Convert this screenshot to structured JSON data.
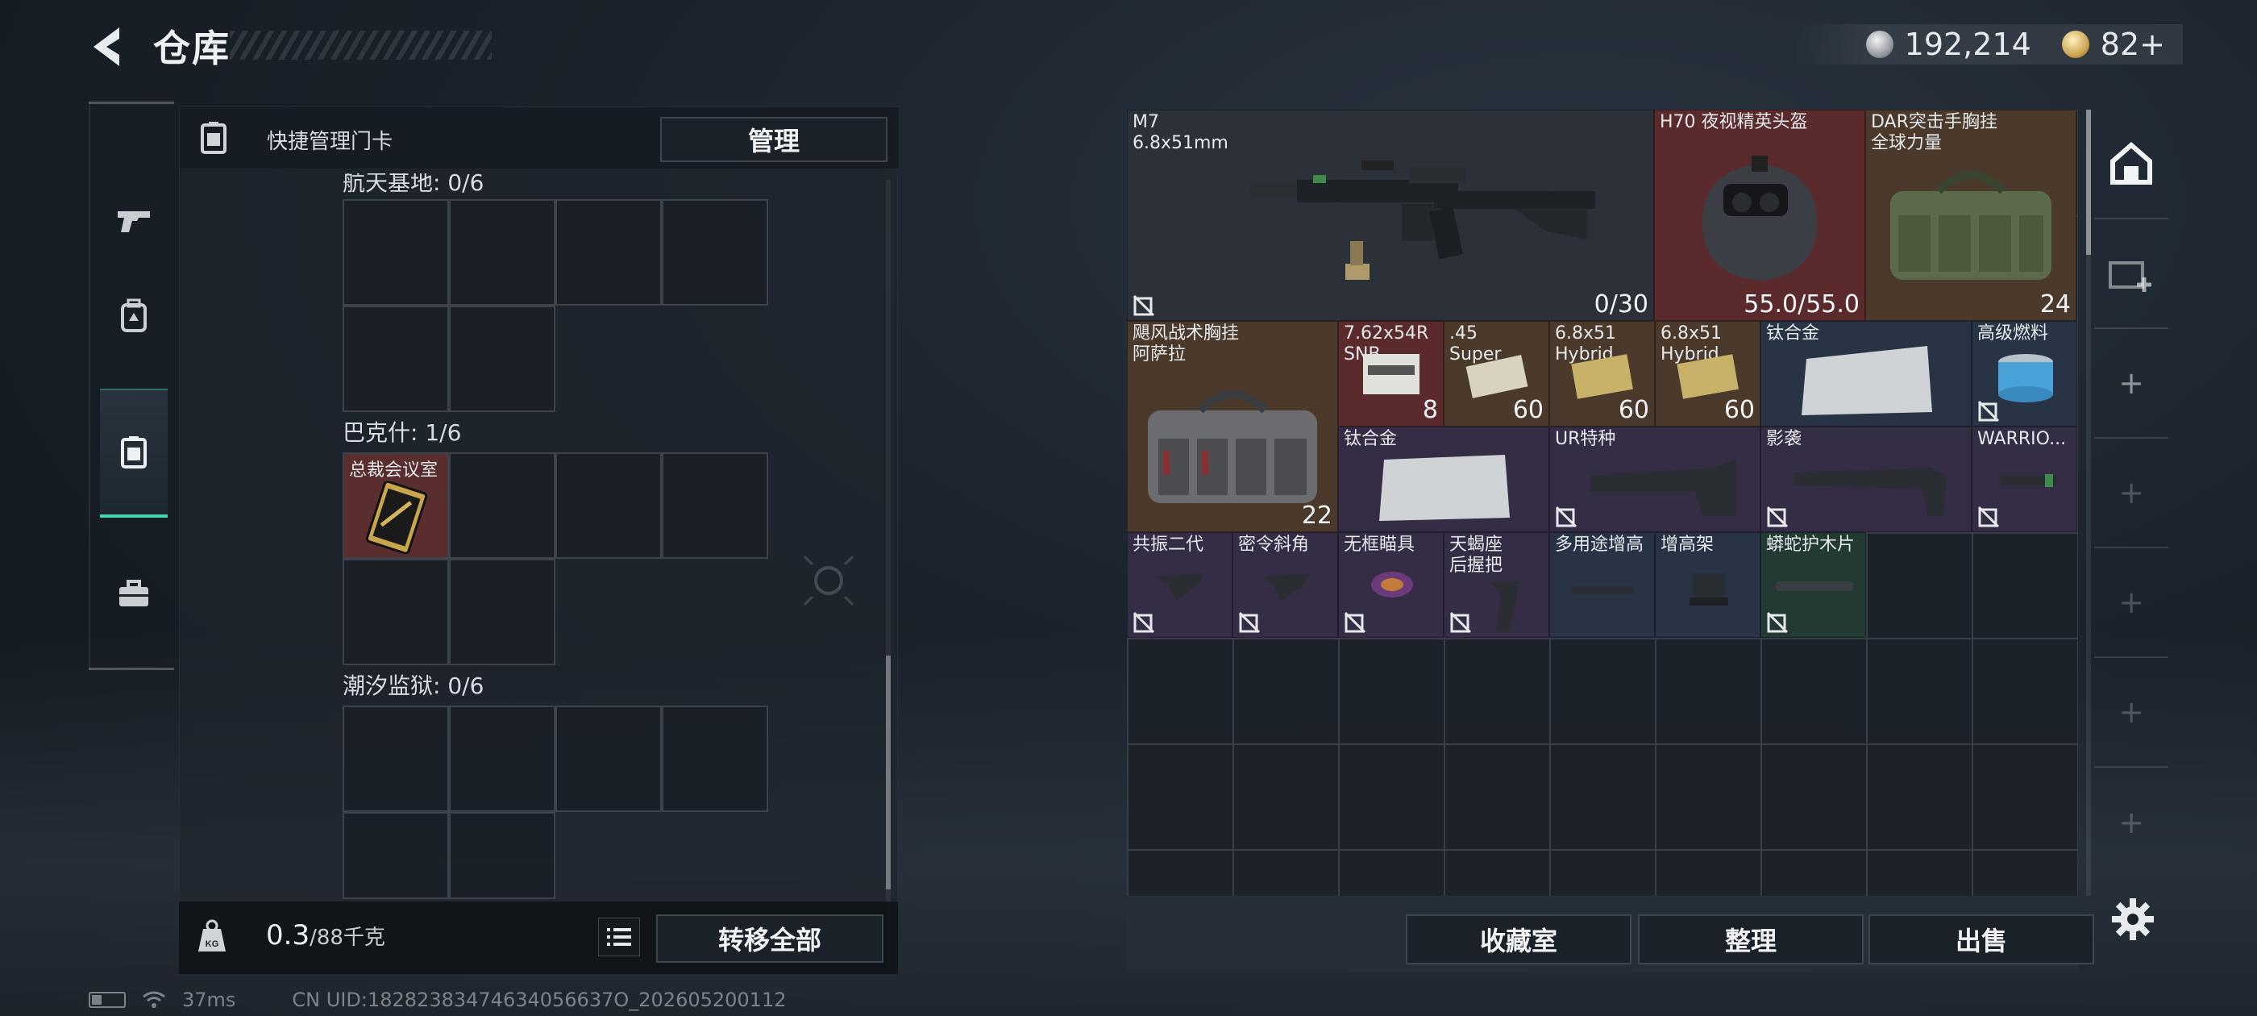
{
  "header": {
    "title": "仓库",
    "currency_silver": "192,214",
    "currency_gold": "82+"
  },
  "left_panel": {
    "quick_manage_label": "快捷管理门卡",
    "manage_button": "管理",
    "sections": [
      {
        "title": "航天基地: 0/6"
      },
      {
        "title": "巴克什: 1/6",
        "filled_slot_name": "总裁会议室"
      },
      {
        "title": "潮汐监狱: 0/6"
      }
    ],
    "weight_value": "0.3",
    "weight_max": "/88千克",
    "transfer_all_button": "转移全部"
  },
  "status_bar": {
    "ping": "37ms",
    "uid": "CN UID:18282383474634056637O_202605200112"
  },
  "inventory": {
    "items": [
      {
        "name": "M7\n6.8x51mm",
        "count": "0/30",
        "color": "gray"
      },
      {
        "name": "H70 夜视精英头盔",
        "count": "55.0/55.0",
        "color": "red"
      },
      {
        "name": "DAR突击手胸挂\n全球力量",
        "count": "24",
        "color": "brown"
      },
      {
        "name": "飓风战术胸挂\n阿萨拉",
        "count": "22",
        "color": "brown"
      },
      {
        "name": "7.62x54R\nSNB",
        "count": "8",
        "color": "red"
      },
      {
        "name": ".45\nSuper",
        "count": "60",
        "color": "brown"
      },
      {
        "name": "6.8x51\nHybrid",
        "count": "60",
        "color": "brown"
      },
      {
        "name": "6.8x51\nHybrid",
        "count": "60",
        "color": "brown"
      },
      {
        "name": "钛合金",
        "count": "",
        "color": "blue"
      },
      {
        "name": "高级燃料",
        "count": "",
        "color": "blue"
      },
      {
        "name": "钛合金",
        "count": "",
        "color": "purple"
      },
      {
        "name": "UR特种",
        "count": "",
        "color": "purple"
      },
      {
        "name": "影袭",
        "count": "",
        "color": "purple"
      },
      {
        "name": "WARRIO...",
        "count": "",
        "color": "purple"
      },
      {
        "name": "共振二代",
        "count": "",
        "color": "purple"
      },
      {
        "name": "密令斜角",
        "count": "",
        "color": "purple"
      },
      {
        "name": "无框瞄具",
        "count": "",
        "color": "purple"
      },
      {
        "name": "天蝎座\n后握把",
        "count": "",
        "color": "purple"
      },
      {
        "name": "多用途增高",
        "count": "",
        "color": "blue"
      },
      {
        "name": "增高架",
        "count": "",
        "color": "blue"
      },
      {
        "name": "蟒蛇护木片",
        "count": "",
        "color": "green"
      }
    ],
    "buttons": {
      "collection": "收藏室",
      "sort": "整理",
      "sell": "出售"
    }
  },
  "right_rail": {
    "plus_glyph": "+"
  }
}
